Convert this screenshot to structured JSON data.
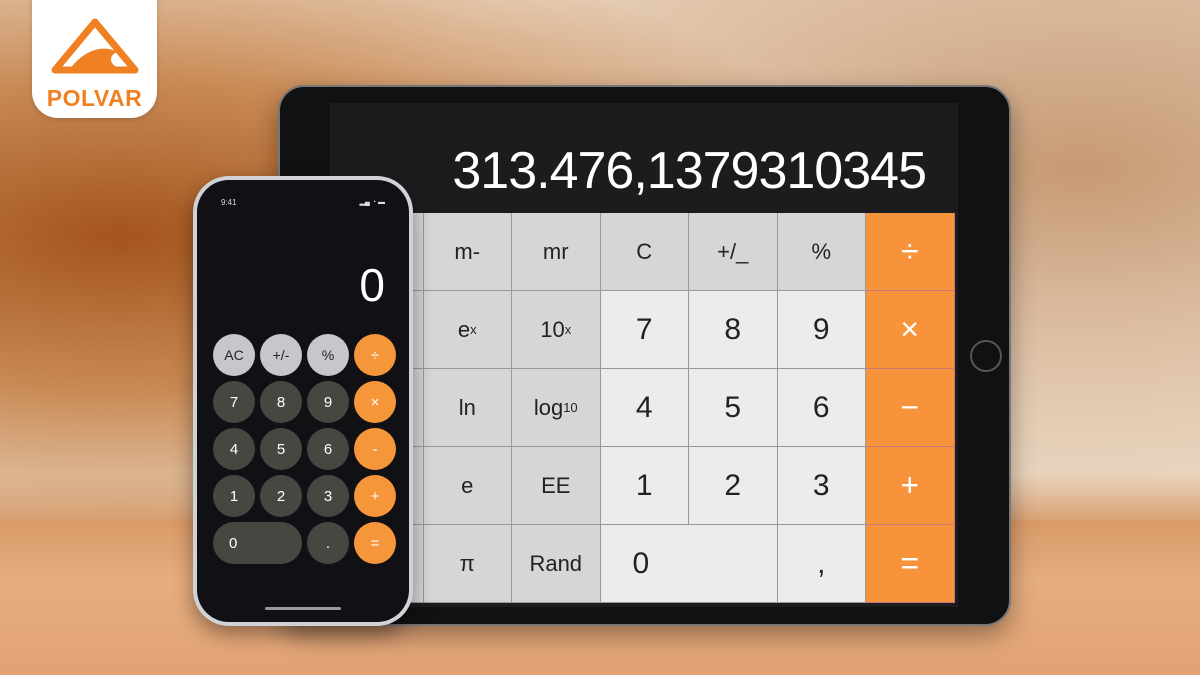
{
  "brand": {
    "name": "POLVAR",
    "color": "#f08122"
  },
  "ipad": {
    "display": "313.476,1379310345",
    "keys": [
      [
        "",
        "m-",
        "mr",
        "C",
        "+/_",
        "%",
        "÷"
      ],
      [
        "",
        "e",
        "10",
        "7",
        "8",
        "9",
        "×"
      ],
      [
        "",
        "ln",
        "log",
        "4",
        "5",
        "6",
        "−"
      ],
      [
        "",
        "e",
        "EE",
        "1",
        "2",
        "3",
        "+"
      ],
      [
        "",
        "π",
        "Rand",
        "0",
        ",",
        "="
      ]
    ],
    "sup": {
      "ex": "x",
      "tenx": "x"
    },
    "sub": {
      "log": "10"
    },
    "accent": "#f7933a"
  },
  "iphone": {
    "time": "9:41",
    "status": "▂▄ ◔ ▬",
    "display": "0",
    "keys": [
      [
        "AC",
        "+/-",
        "%",
        "÷"
      ],
      [
        "7",
        "8",
        "9",
        "×"
      ],
      [
        "4",
        "5",
        "6",
        "-"
      ],
      [
        "1",
        "2",
        "3",
        "+"
      ],
      [
        "0",
        ".",
        "="
      ]
    ],
    "accent": "#f5963a"
  }
}
